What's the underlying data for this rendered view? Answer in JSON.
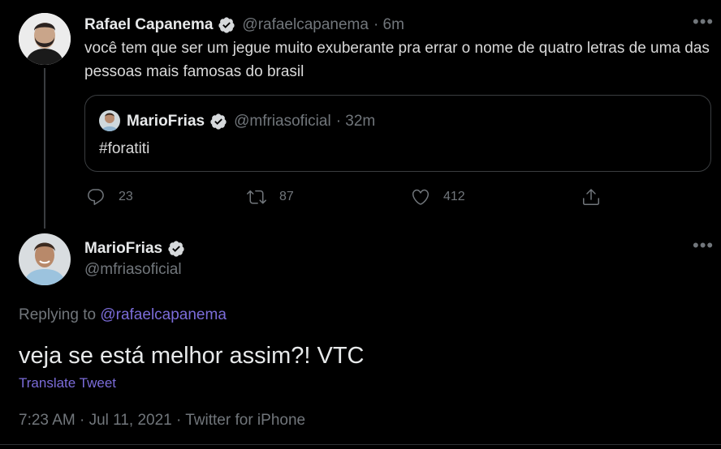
{
  "quote_tweet": {
    "author_name": "Rafael Capanema",
    "author_handle": "@rafaelcapanema",
    "time": "· 6m",
    "text": "você tem que ser um jegue muito exuberante pra errar o nome de quatro letras de uma das pessoas mais famosas do brasil",
    "quoted": {
      "author_name": "MarioFrias",
      "author_handle": "@mfriasoficial",
      "time": "· 32m",
      "text": "#foratiti"
    },
    "actions": {
      "replies": "23",
      "retweets": "87",
      "likes": "412"
    }
  },
  "main_tweet": {
    "author_name": "MarioFrias",
    "author_handle": "@mfriasoficial",
    "replying_prefix": "Replying to",
    "replying_to": "@rafaelcapanema",
    "text": "veja se está melhor assim?! VTC",
    "translate_label": "Translate Tweet",
    "meta": "7:23 AM · Jul 11, 2021 · Twitter for iPhone"
  },
  "colors": {
    "background": "#000000",
    "accent": "#7b6cd9",
    "muted": "#71767b"
  }
}
